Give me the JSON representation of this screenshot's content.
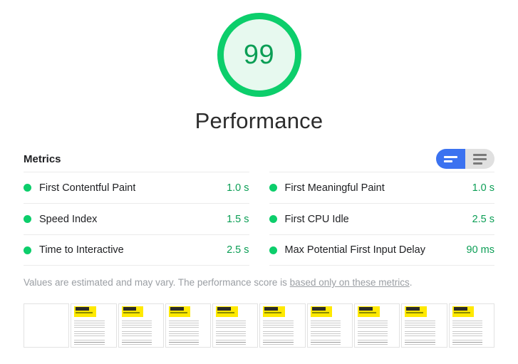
{
  "gauge": {
    "score": "99",
    "title": "Performance",
    "ring_color": "#0cce6b",
    "fill_color": "#e7f9ef",
    "score_color": "#0b9e55"
  },
  "metrics_section": {
    "title": "Metrics",
    "toggle": {
      "active_view": "simple-view",
      "active_color": "#3b72f0",
      "inactive_color": "#e0e0e0",
      "options": [
        {
          "name": "simple-view",
          "bars": 2,
          "selected": true
        },
        {
          "name": "expanded-view",
          "bars": 3,
          "selected": false
        }
      ]
    },
    "status_color": "#0cce6b",
    "value_color": "#0b9e55",
    "columns": [
      {
        "rows": [
          {
            "label": "First Contentful Paint",
            "value": "1.0 s",
            "status": "pass"
          },
          {
            "label": "Speed Index",
            "value": "1.5 s",
            "status": "pass"
          },
          {
            "label": "Time to Interactive",
            "value": "2.5 s",
            "status": "pass"
          }
        ]
      },
      {
        "rows": [
          {
            "label": "First Meaningful Paint",
            "value": "1.0 s",
            "status": "pass"
          },
          {
            "label": "First CPU Idle",
            "value": "2.5 s",
            "status": "pass"
          },
          {
            "label": "Max Potential First Input Delay",
            "value": "90 ms",
            "status": "pass"
          }
        ]
      }
    ]
  },
  "disclaimer": {
    "prefix": "Values are estimated and may vary. The performance score is ",
    "link_text": "based only on these metrics",
    "suffix": "."
  },
  "filmstrip": {
    "banner_color": "#ffe900",
    "frames": [
      {
        "index": 1,
        "blank": true
      },
      {
        "index": 2,
        "blank": false
      },
      {
        "index": 3,
        "blank": false
      },
      {
        "index": 4,
        "blank": false
      },
      {
        "index": 5,
        "blank": false
      },
      {
        "index": 6,
        "blank": false
      },
      {
        "index": 7,
        "blank": false
      },
      {
        "index": 8,
        "blank": false
      },
      {
        "index": 9,
        "blank": false
      },
      {
        "index": 10,
        "blank": false
      }
    ]
  }
}
